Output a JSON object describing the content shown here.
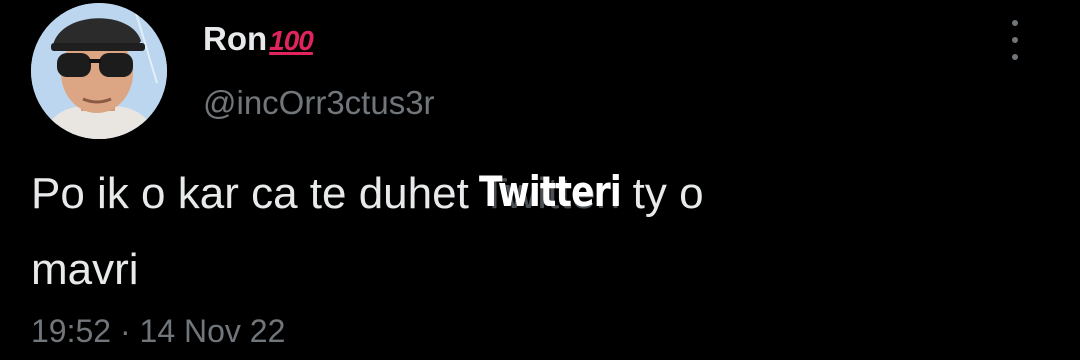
{
  "user": {
    "display_name": "Ron",
    "name_emoji": "100",
    "handle": "@incOrr3ctus3r"
  },
  "tweet": {
    "text_before": "Po ik o kar ca te duhet ",
    "text_obscured": "Twitteri",
    "text_after": " ty o",
    "text_line2": "mavri",
    "overlay_text": "Twitteri"
  },
  "meta": {
    "timestamp": "19:52 · 14 Nov 22"
  },
  "icons": {
    "more": "more-vertical-icon",
    "emoji": "hundred-points-emoji"
  },
  "colors": {
    "background": "#000000",
    "primary_text": "#e7e9ea",
    "secondary_text": "#71767b",
    "emoji_red": "#e0245e"
  }
}
